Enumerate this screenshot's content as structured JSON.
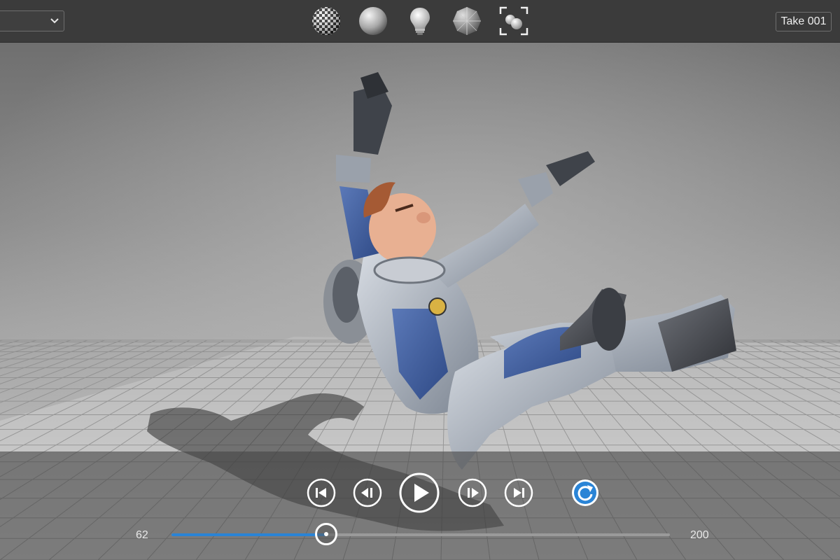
{
  "topbar": {
    "scene_dropdown_value": "",
    "tools": [
      {
        "icon": "checker-sphere-icon"
      },
      {
        "icon": "shaded-sphere-icon"
      },
      {
        "icon": "light-bulb-icon"
      },
      {
        "icon": "wireframe-sphere-icon"
      },
      {
        "icon": "frame-selection-icon"
      }
    ],
    "take_label": "Take 001"
  },
  "playback": {
    "buttons": [
      {
        "icon": "skip-to-start-icon"
      },
      {
        "icon": "step-back-icon"
      },
      {
        "icon": "play-icon"
      },
      {
        "icon": "step-forward-icon"
      },
      {
        "icon": "skip-to-end-icon"
      },
      {
        "icon": "loop-icon"
      }
    ],
    "current_frame": "62",
    "end_frame": "200",
    "scrubber_fraction": 0.31
  },
  "colors": {
    "accent": "#2a84d6",
    "topbar_bg": "#3b3b3b",
    "stage_bg": "#7a7a7a"
  }
}
